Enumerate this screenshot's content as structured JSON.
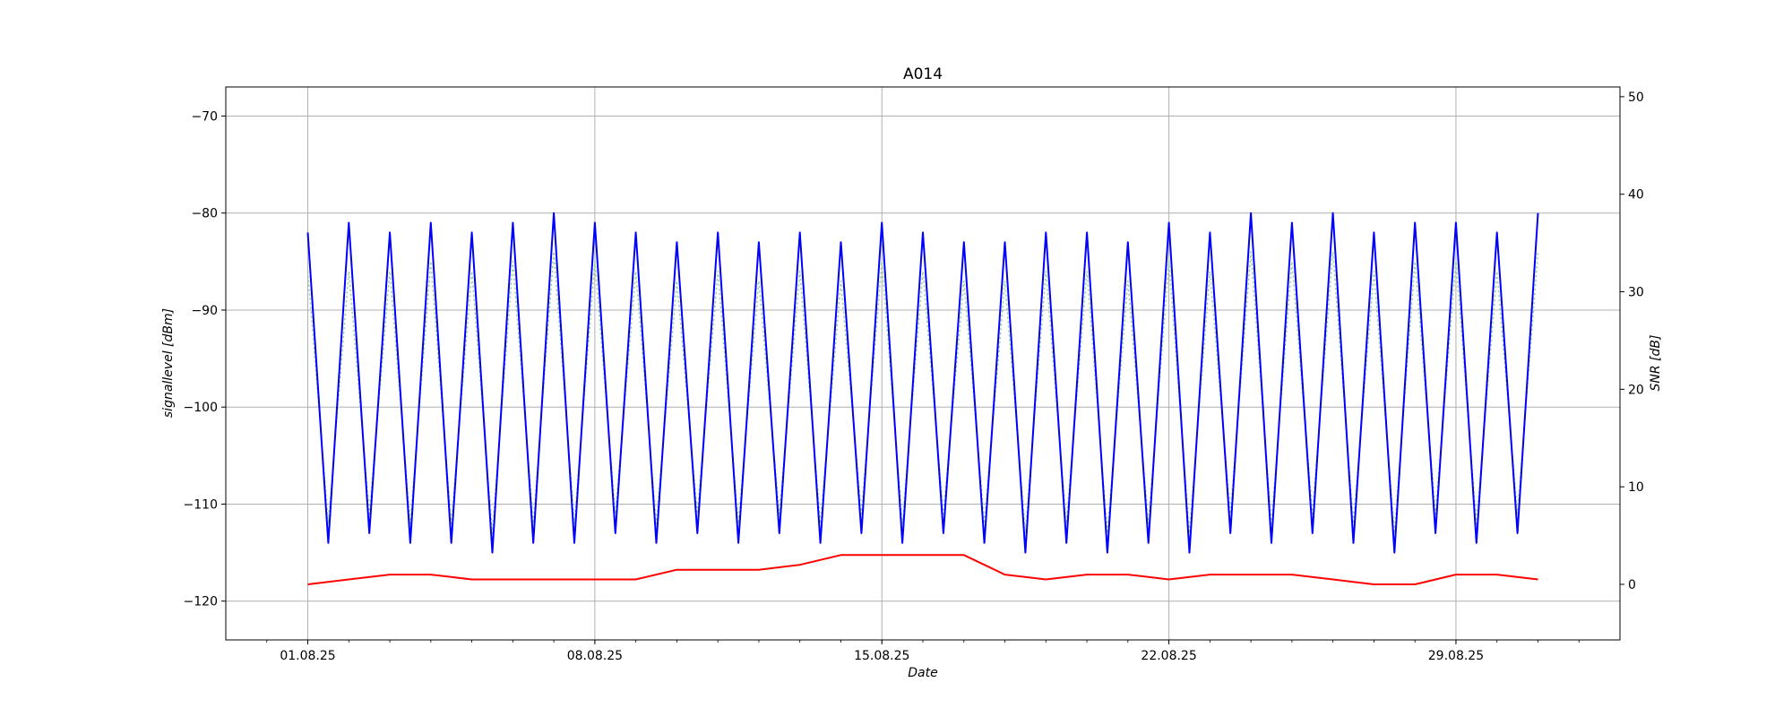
{
  "chart_data": {
    "type": "line",
    "title": "A014",
    "xlabel": "Date",
    "ylabel_left": "signallevel [dBm]",
    "ylabel_right": "SNR [dB]",
    "x_ticks": [
      "01.08.25",
      "08.08.25",
      "15.08.25",
      "22.08.25",
      "29.08.25"
    ],
    "xlim": [
      "30.07.25",
      "02.09.25"
    ],
    "ylim_left": [
      -124,
      -67
    ],
    "ylim_right": [
      -5.7,
      51
    ],
    "yticks_left": [
      -70,
      -80,
      -90,
      -100,
      -110,
      -120
    ],
    "yticks_right": [
      50,
      40,
      30,
      20,
      10,
      0
    ],
    "grid": true,
    "series": [
      {
        "axis": "left",
        "color": "#0000ff",
        "style": "solid",
        "x": [
          "01.08.25",
          "01.08.25 12:00",
          "02.08.25",
          "02.08.25 12:00",
          "03.08.25",
          "03.08.25 12:00",
          "04.08.25",
          "04.08.25 12:00",
          "05.08.25",
          "05.08.25 12:00",
          "06.08.25",
          "06.08.25 12:00",
          "07.08.25",
          "07.08.25 12:00",
          "08.08.25",
          "08.08.25 12:00",
          "09.08.25",
          "09.08.25 12:00",
          "10.08.25",
          "10.08.25 12:00",
          "11.08.25",
          "11.08.25 12:00",
          "12.08.25",
          "12.08.25 12:00",
          "13.08.25",
          "13.08.25 12:00",
          "14.08.25",
          "14.08.25 12:00",
          "15.08.25",
          "15.08.25 12:00",
          "16.08.25",
          "16.08.25 12:00",
          "17.08.25",
          "17.08.25 12:00",
          "18.08.25",
          "18.08.25 12:00",
          "19.08.25",
          "19.08.25 12:00",
          "20.08.25",
          "20.08.25 12:00",
          "21.08.25",
          "21.08.25 12:00",
          "22.08.25",
          "22.08.25 12:00",
          "23.08.25",
          "23.08.25 12:00",
          "24.08.25",
          "24.08.25 12:00",
          "25.08.25",
          "25.08.25 12:00",
          "26.08.25",
          "26.08.25 12:00",
          "27.08.25",
          "27.08.25 12:00",
          "28.08.25",
          "28.08.25 12:00",
          "29.08.25",
          "29.08.25 12:00",
          "30.08.25",
          "30.08.25 12:00",
          "31.08.25"
        ],
        "values": [
          -82,
          -114,
          -81,
          -113,
          -82,
          -114,
          -81,
          -114,
          -82,
          -115,
          -81,
          -114,
          -80,
          -114,
          -81,
          -113,
          -82,
          -114,
          -83,
          -113,
          -82,
          -114,
          -83,
          -113,
          -82,
          -114,
          -83,
          -113,
          -81,
          -114,
          -82,
          -113,
          -83,
          -114,
          -83,
          -115,
          -82,
          -114,
          -82,
          -115,
          -83,
          -114,
          -81,
          -115,
          -82,
          -113,
          -80,
          -114,
          -81,
          -113,
          -80,
          -114,
          -82,
          -115,
          -81,
          -113,
          -81,
          -114,
          -82,
          -113,
          -80
        ]
      },
      {
        "axis": "right",
        "color": "#ff0000",
        "style": "solid",
        "x": [
          "01.08.25",
          "02.08.25",
          "03.08.25",
          "04.08.25",
          "05.08.25",
          "06.08.25",
          "07.08.25",
          "08.08.25",
          "09.08.25",
          "10.08.25",
          "11.08.25",
          "12.08.25",
          "13.08.25",
          "14.08.25",
          "15.08.25",
          "16.08.25",
          "17.08.25",
          "18.08.25",
          "19.08.25",
          "20.08.25",
          "21.08.25",
          "22.08.25",
          "23.08.25",
          "24.08.25",
          "25.08.25",
          "26.08.25",
          "27.08.25",
          "28.08.25",
          "29.08.25",
          "30.08.25",
          "31.08.25"
        ],
        "values": [
          0,
          0.5,
          1,
          1,
          0.5,
          0.5,
          0.5,
          0.5,
          0.5,
          1.5,
          1.5,
          1.5,
          2,
          3,
          3,
          3,
          3,
          1,
          0.5,
          1,
          1,
          0.5,
          1,
          1,
          1,
          0.5,
          0,
          0,
          1,
          1,
          0.5
        ]
      },
      {
        "axis": "left",
        "color": "#8fd08f",
        "style": "dotted",
        "x": [
          "01.08.25",
          "01.08.25 12:00",
          "02.08.25",
          "02.08.25 12:00",
          "03.08.25",
          "03.08.25 12:00",
          "04.08.25",
          "04.08.25 12:00",
          "05.08.25",
          "05.08.25 12:00",
          "06.08.25",
          "06.08.25 12:00",
          "07.08.25",
          "07.08.25 12:00",
          "08.08.25",
          "08.08.25 12:00",
          "09.08.25",
          "09.08.25 12:00",
          "10.08.25",
          "10.08.25 12:00",
          "11.08.25",
          "11.08.25 12:00",
          "12.08.25",
          "12.08.25 12:00",
          "13.08.25",
          "13.08.25 12:00",
          "14.08.25",
          "14.08.25 12:00",
          "15.08.25",
          "15.08.25 12:00",
          "16.08.25",
          "16.08.25 12:00",
          "17.08.25",
          "17.08.25 12:00",
          "18.08.25",
          "18.08.25 12:00",
          "19.08.25",
          "19.08.25 12:00",
          "20.08.25",
          "20.08.25 12:00",
          "21.08.25",
          "21.08.25 12:00",
          "22.08.25",
          "22.08.25 12:00",
          "23.08.25",
          "23.08.25 12:00",
          "24.08.25",
          "24.08.25 12:00",
          "25.08.25",
          "25.08.25 12:00",
          "26.08.25",
          "26.08.25 12:00",
          "27.08.25",
          "27.08.25 12:00",
          "28.08.25",
          "28.08.25 12:00",
          "29.08.25",
          "29.08.25 12:00",
          "30.08.25",
          "30.08.25 12:00",
          "31.08.25"
        ],
        "values": [
          -86,
          -112,
          -86,
          -111,
          -86,
          -112,
          -85,
          -112,
          -86,
          -113,
          -85,
          -112,
          -84,
          -112,
          -85,
          -111,
          -86,
          -112,
          -87,
          -111,
          -86,
          -112,
          -87,
          -111,
          -86,
          -112,
          -87,
          -111,
          -85,
          -112,
          -86,
          -111,
          -87,
          -112,
          -87,
          -113,
          -86,
          -112,
          -86,
          -113,
          -87,
          -112,
          -85,
          -113,
          -86,
          -111,
          -84,
          -112,
          -85,
          -111,
          -84,
          -112,
          -86,
          -113,
          -85,
          -111,
          -85,
          -112,
          -86,
          -111,
          -84
        ]
      }
    ]
  }
}
